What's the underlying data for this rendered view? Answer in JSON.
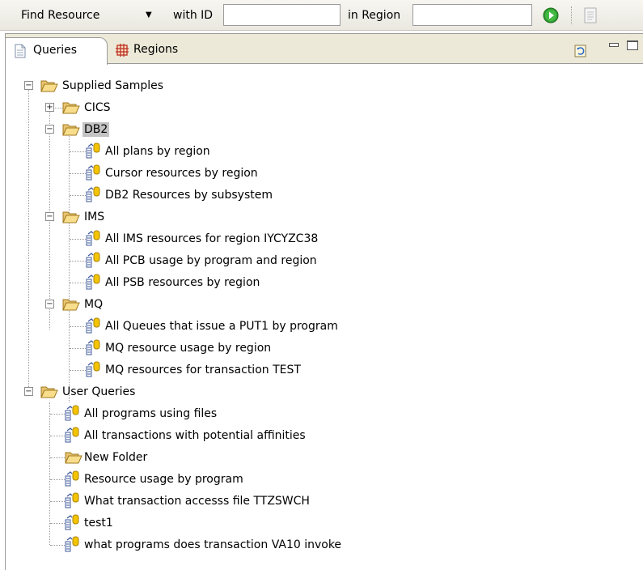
{
  "toolbar": {
    "find_select": "Find Resource",
    "with_id_label": "with ID",
    "id_value": "",
    "in_region_label": "in Region",
    "region_value": ""
  },
  "tabs": [
    {
      "label": "Queries",
      "active": true
    },
    {
      "label": "Regions",
      "active": false
    }
  ],
  "tree": {
    "supplied_samples": {
      "label": "Supplied Samples",
      "cics": {
        "label": "CICS"
      },
      "db2": {
        "label": "DB2",
        "items": [
          "All plans by region",
          "Cursor resources by region",
          "DB2 Resources by subsystem"
        ]
      },
      "ims": {
        "label": "IMS",
        "items": [
          "All IMS resources for region IYCYZC38",
          "All PCB usage by program and region",
          "All PSB resources by region"
        ]
      },
      "mq": {
        "label": "MQ",
        "items": [
          "All Queues that issue a PUT1 by program",
          "MQ resource usage by region",
          "MQ resources for transaction TEST"
        ]
      }
    },
    "user_queries": {
      "label": "User Queries",
      "items": [
        "All programs using files",
        "All transactions with potential affinities",
        "New Folder",
        "Resource usage by program",
        "What transaction accesss file TTZSWCH",
        "test1",
        "what programs does transaction VA10 invoke"
      ]
    }
  }
}
